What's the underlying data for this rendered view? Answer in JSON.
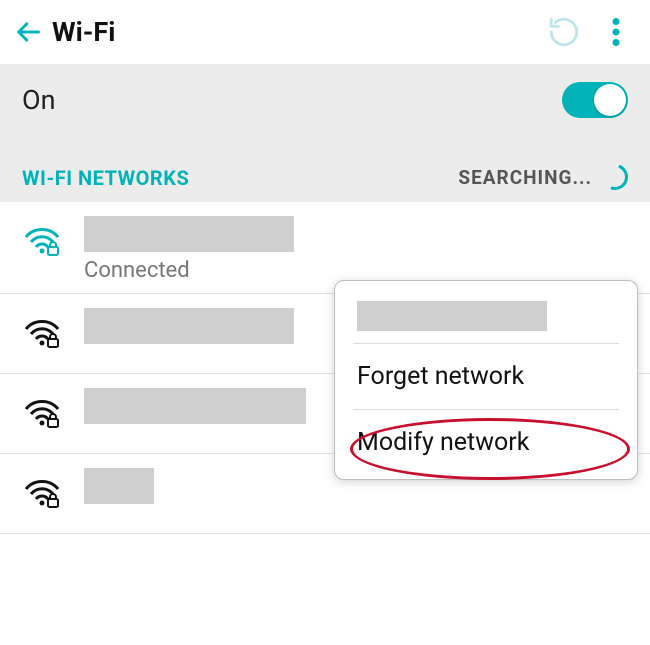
{
  "appbar": {
    "title": "Wi-Fi"
  },
  "wifi": {
    "state_label": "On",
    "section_label": "WI-FI NETWORKS",
    "searching_label": "SEARCHING..."
  },
  "networks": [
    {
      "status": "Connected"
    },
    {
      "status": ""
    },
    {
      "status": ""
    },
    {
      "status": ""
    }
  ],
  "popup": {
    "forget": "Forget network",
    "modify": "Modify network"
  }
}
